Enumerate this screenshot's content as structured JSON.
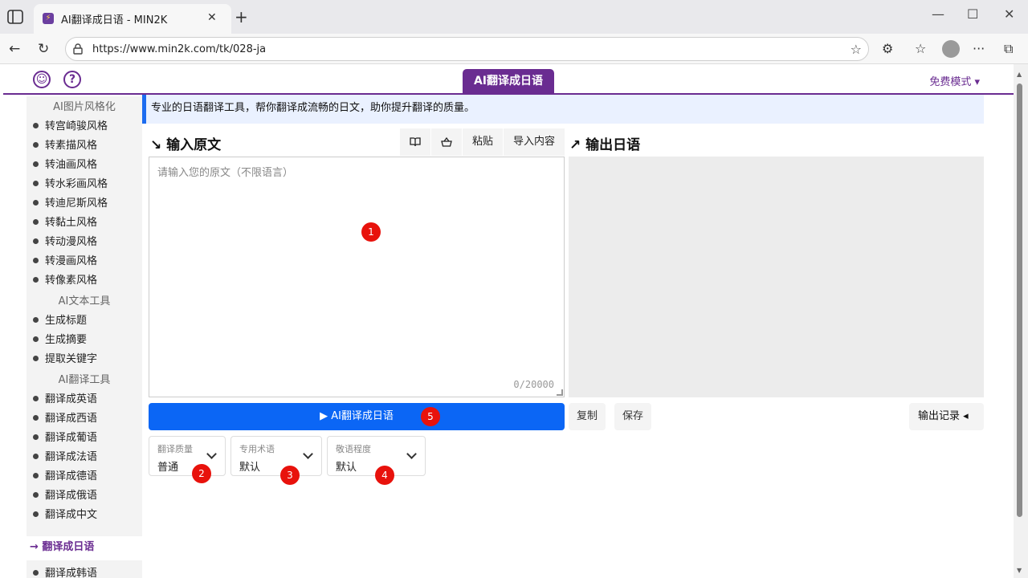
{
  "browser": {
    "tab_title": "AI翻译成日语 - MIN2K",
    "tab_close": "✕",
    "new_tab": "+",
    "url": "https://www.min2k.com/tk/028-ja",
    "win_min": "—",
    "win_max": "☐",
    "win_close": "✕",
    "more": "···"
  },
  "header": {
    "title": "AI翻译成日语",
    "mode": "免费模式 ▾",
    "user_icon": "user-circle-icon",
    "help_icon": "help-circle-icon"
  },
  "sidebar": {
    "groups": [
      {
        "title": "AI图片风格化",
        "items": [
          "转宫崎骏风格",
          "转素描风格",
          "转油画风格",
          "转水彩画风格",
          "转迪尼斯风格",
          "转黏土风格",
          "转动漫风格",
          "转漫画风格",
          "转像素风格"
        ]
      },
      {
        "title": "AI文本工具",
        "items": [
          "生成标题",
          "生成摘要",
          "提取关键字"
        ]
      },
      {
        "title": "AI翻译工具",
        "items": [
          "翻译成英语",
          "翻译成西语",
          "翻译成葡语",
          "翻译成法语",
          "翻译成德语",
          "翻译成俄语",
          "翻译成中文"
        ]
      }
    ],
    "active_item": "翻译成日语",
    "next_item": "翻译成韩语"
  },
  "banner": "专业的日语翻译工具，帮你翻译成流畅的日文，助你提升翻译的质量。",
  "input": {
    "heading": "输入原文",
    "placeholder": "请输入您的原文（不限语言）",
    "counter": "0/20000",
    "tools": {
      "paste": "粘贴",
      "import": "导入内容"
    }
  },
  "output": {
    "heading": "输出日语"
  },
  "actions": {
    "translate": "▶ AI翻译成日语",
    "copy": "复制",
    "save": "保存",
    "history": "输出记录 ◂"
  },
  "options": [
    {
      "label": "翻译质量",
      "value": "普通"
    },
    {
      "label": "专用术语",
      "value": "默认"
    },
    {
      "label": "敬语程度",
      "value": "默认"
    }
  ],
  "badges": [
    "1",
    "2",
    "3",
    "4",
    "5"
  ],
  "colors": {
    "brand": "#6a2c91",
    "primary": "#0b66f5",
    "badge": "#e8120c"
  }
}
